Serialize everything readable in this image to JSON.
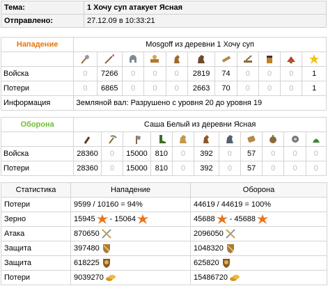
{
  "header": {
    "subject_label": "Тема:",
    "subject_value": "1 Хочу суп атакует Ясная",
    "sent_label": "Отправлено:",
    "sent_value": "27.12.09 в 10:33:21"
  },
  "attack": {
    "role": "Нападение",
    "title": "Mosgoff из деревни 1 Хочу суп",
    "icons": [
      "mace-icon",
      "spear-icon",
      "helmet-icon",
      "horseman-icon",
      "horse-knight-icon",
      "horse-icon",
      "ram-icon",
      "catapult-icon",
      "chief-icon",
      "settler-icon",
      "hero-icon"
    ],
    "rows": [
      {
        "label": "Войска",
        "values": [
          "0",
          "7266",
          "0",
          "0",
          "0",
          "2819",
          "74",
          "0",
          "0",
          "0",
          "1"
        ]
      },
      {
        "label": "Потери",
        "values": [
          "0",
          "6865",
          "0",
          "0",
          "0",
          "2663",
          "70",
          "0",
          "0",
          "0",
          "1"
        ]
      }
    ],
    "info_label": "Информация",
    "info_value": "Земляной вал: Разрушено с уровня 20 до уровня 19"
  },
  "defense": {
    "role": "Оборона",
    "title": "Саша Белый из деревни Ясная",
    "icons": [
      "club-icon",
      "pickaxe-icon",
      "axe-icon",
      "boot-icon",
      "horse-icon",
      "helmet-icon",
      "horse-knight-icon",
      "log-icon",
      "bomb-icon",
      "settler-icon",
      "hero-icon"
    ],
    "rows": [
      {
        "label": "Войска",
        "values": [
          "28360",
          "0",
          "15000",
          "810",
          "0",
          "392",
          "0",
          "57",
          "0",
          "0",
          "0"
        ]
      },
      {
        "label": "Потери",
        "values": [
          "28360",
          "0",
          "15000",
          "810",
          "0",
          "392",
          "0",
          "57",
          "0",
          "0",
          "0"
        ]
      }
    ]
  },
  "stats": {
    "header": [
      "Статистика",
      "Нападение",
      "Оборона"
    ],
    "rows": [
      {
        "label": "Потери",
        "attack": "9599 / 10160 = 94%",
        "defense": "44619 / 44619 = 100%",
        "icon": ""
      },
      {
        "label": "Зерно",
        "attack": "15945",
        "attack2": " - 15064",
        "defense": "45688",
        "defense2": " - 45688",
        "icon": "grain-burst-icon"
      },
      {
        "label": "Атака",
        "attack": "870650",
        "defense": "2096050",
        "icon": "crossed-swords-icon"
      },
      {
        "label": "Защита",
        "attack": "397480",
        "defense": "1048320",
        "icon": "shield-icon"
      },
      {
        "label": "Защита",
        "attack": "618225",
        "defense": "625820",
        "icon": "horse-shield-icon"
      },
      {
        "label": "Потери",
        "attack": "9039270",
        "defense": "15486720",
        "icon": "coins-icon"
      }
    ]
  }
}
